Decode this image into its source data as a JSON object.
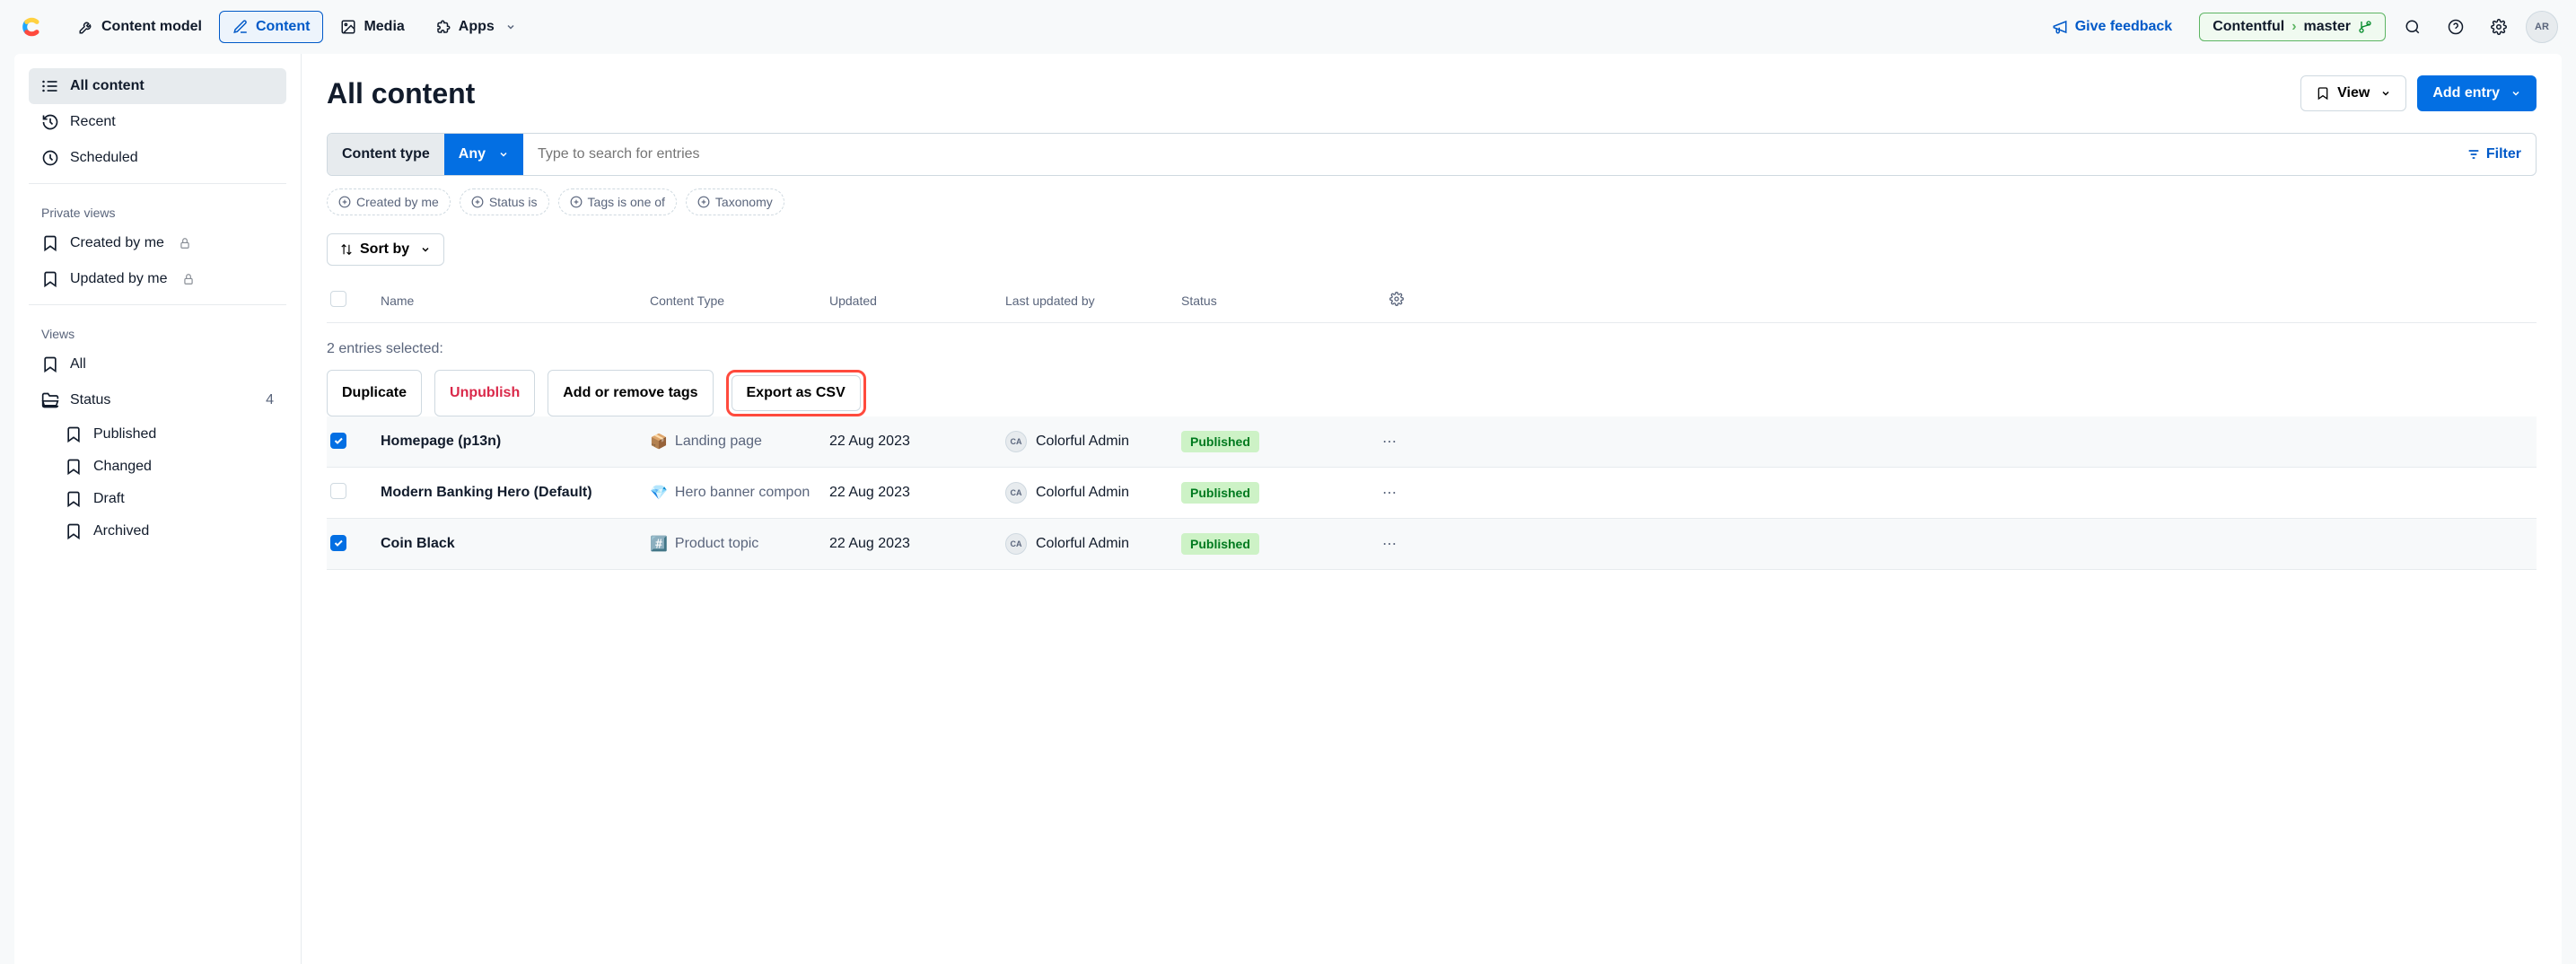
{
  "nav": {
    "content_model": "Content model",
    "content": "Content",
    "media": "Media",
    "apps": "Apps",
    "feedback": "Give feedback",
    "space": "Contentful",
    "env": "master",
    "avatar": "AR"
  },
  "sidebar": {
    "all_content": "All content",
    "recent": "Recent",
    "scheduled": "Scheduled",
    "private_views_label": "Private views",
    "created_by_me": "Created by me",
    "updated_by_me": "Updated by me",
    "views_label": "Views",
    "all": "All",
    "status": "Status",
    "status_count": "4",
    "status_items": {
      "published": "Published",
      "changed": "Changed",
      "draft": "Draft",
      "archived": "Archived"
    }
  },
  "main": {
    "title": "All content",
    "view_btn": "View",
    "add_entry_btn": "Add entry",
    "content_type_label": "Content type",
    "content_type_value": "Any",
    "search_placeholder": "Type to search for entries",
    "filter_label": "Filter",
    "chips": {
      "created_by_me": "Created by me",
      "status_is": "Status is",
      "tags_is_one_of": "Tags is one of",
      "taxonomy": "Taxonomy"
    },
    "sort_by": "Sort by",
    "columns": {
      "name": "Name",
      "content_type": "Content Type",
      "updated": "Updated",
      "last_updated_by": "Last updated by",
      "status": "Status"
    },
    "selection_text": "2 entries selected:",
    "bulk": {
      "duplicate": "Duplicate",
      "unpublish": "Unpublish",
      "tags": "Add or remove tags",
      "export_csv": "Export as CSV"
    },
    "rows": [
      {
        "selected": true,
        "name": "Homepage (p13n)",
        "type_icon": "📦",
        "type": "Landing page",
        "updated": "22 Aug 2023",
        "user": "Colorful Admin",
        "user_initials": "CA",
        "status": "Published"
      },
      {
        "selected": false,
        "name": "Modern Banking Hero (Default)",
        "type_icon": "💎",
        "type": "Hero banner compon",
        "updated": "22 Aug 2023",
        "user": "Colorful Admin",
        "user_initials": "CA",
        "status": "Published"
      },
      {
        "selected": true,
        "name": "Coin Black",
        "type_icon": "#️⃣",
        "type": "Product topic",
        "updated": "22 Aug 2023",
        "user": "Colorful Admin",
        "user_initials": "CA",
        "status": "Published"
      }
    ]
  }
}
